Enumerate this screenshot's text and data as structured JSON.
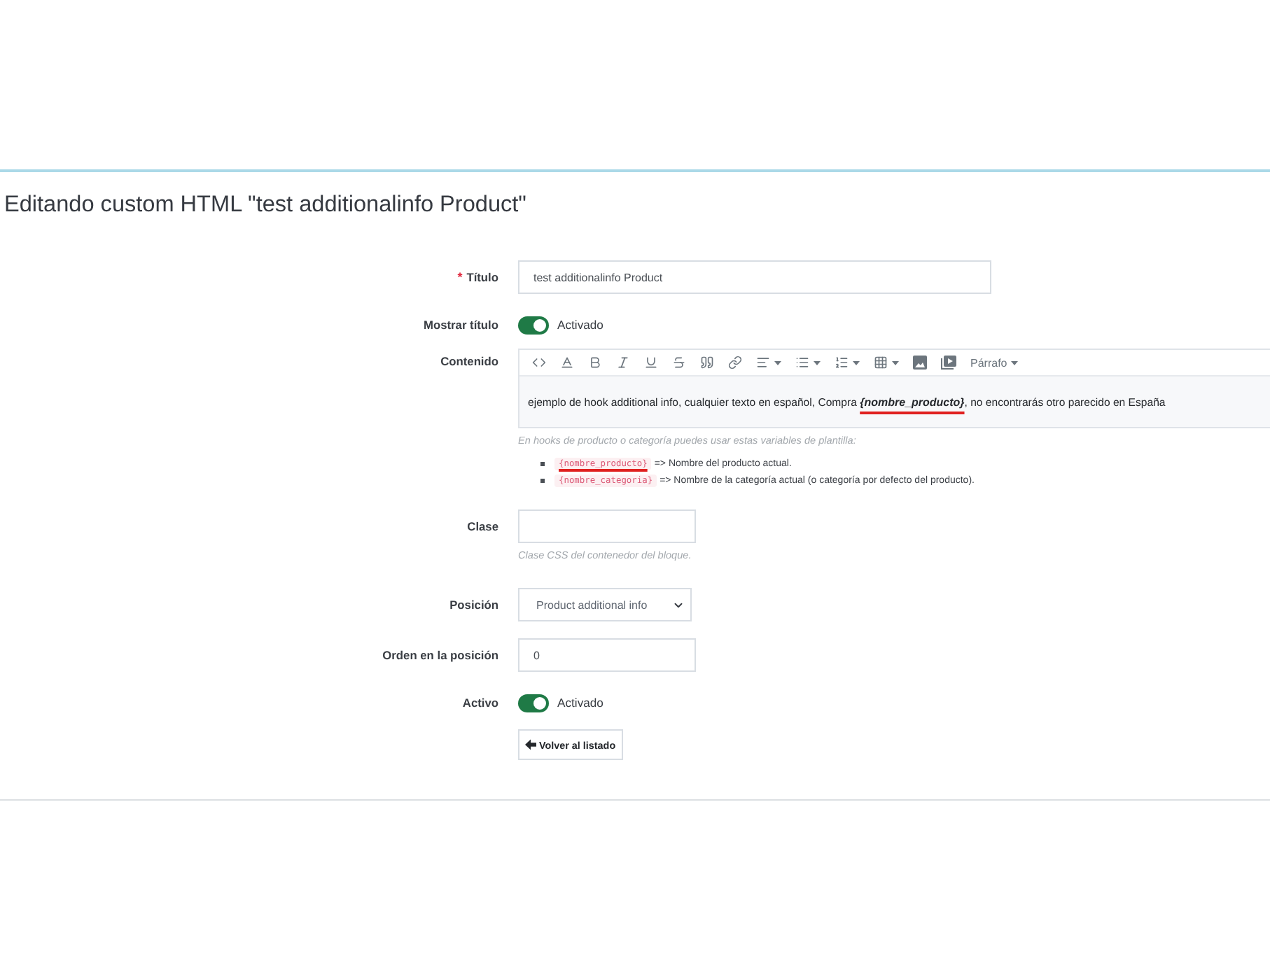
{
  "page_title": "Editando custom HTML \"test additionalinfo Product\"",
  "form": {
    "fields": [
      {
        "kind": "text",
        "label": "Título",
        "required_mark": "*",
        "value": "test additionalinfo Product"
      },
      {
        "kind": "switch",
        "label": "Mostrar título",
        "on": true,
        "state_label": "Activado"
      },
      {
        "kind": "editor",
        "label": "Contenido",
        "format_dropdown": "Párrafo",
        "content": "ejemplo de hook additional info, cualquier texto en español, Compra **{nombre_producto}**, no encontrarás otro parecido en España",
        "content_annotated": true,
        "help": "En hooks de producto o categoría puedes usar estas variables de plantilla:",
        "variables": [
          {
            "code": "{nombre_producto}",
            "description": "=> Nombre del producto actual.",
            "annotated": true
          },
          {
            "code": "{nombre_categoria}",
            "description": "=> Nombre de la categoría actual (o categoría por defecto del producto).",
            "annotated": false
          }
        ]
      },
      {
        "kind": "text",
        "label": "Clase",
        "help": "Clase CSS del contenedor del bloque."
      },
      {
        "kind": "select",
        "label": "Posición",
        "value": "Product additional info"
      },
      {
        "kind": "text",
        "label": "Orden en la posición",
        "value": "0"
      },
      {
        "kind": "switch",
        "label": "Activo",
        "on": true,
        "state_label": "Activado"
      }
    ]
  },
  "back_button": {
    "label": "Volver al listado"
  }
}
